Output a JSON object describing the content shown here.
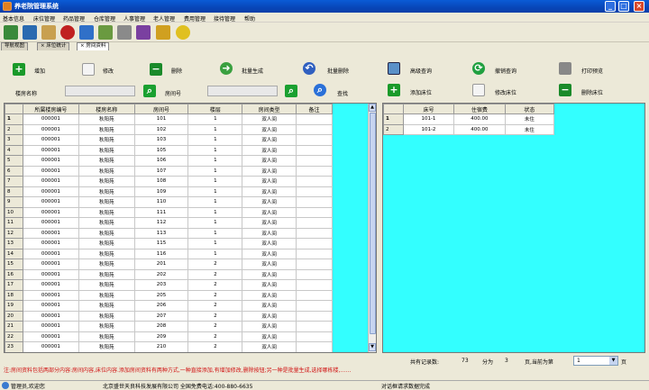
{
  "window": {
    "title": "养老院管理系统"
  },
  "menu": [
    "基本信息",
    "床位管理",
    "药品管理",
    "仓库管理",
    "人事管理",
    "老人管理",
    "费用管理",
    "接待管理",
    "帮助"
  ],
  "tabs": [
    "导航视图",
    "床位统计",
    "房间资料"
  ],
  "actions": {
    "add": "增加",
    "edit": "修改",
    "delete": "删除",
    "batch_create": "批量生成",
    "batch_delete": "批量删除",
    "advanced_query": "高级查询",
    "cancel_query": "撤销查询",
    "print_preview": "打印预览",
    "add_bed": "添加床位",
    "edit_bed": "修改床位",
    "delete_bed": "删除床位",
    "search": "查找"
  },
  "filters": {
    "building_label": "楼房名称",
    "room_label": "房间号"
  },
  "rooms_table": {
    "columns": [
      "所属楼房编号",
      "楼房名称",
      "房间号",
      "楼层",
      "房间类型",
      "备注"
    ],
    "rows": [
      [
        "000001",
        "秋阳苑",
        "101",
        "1",
        "双人间",
        ""
      ],
      [
        "000001",
        "秋阳苑",
        "102",
        "1",
        "双人间",
        ""
      ],
      [
        "000001",
        "秋阳苑",
        "103",
        "1",
        "双人间",
        ""
      ],
      [
        "000001",
        "秋阳苑",
        "105",
        "1",
        "双人间",
        ""
      ],
      [
        "000001",
        "秋阳苑",
        "106",
        "1",
        "双人间",
        ""
      ],
      [
        "000001",
        "秋阳苑",
        "107",
        "1",
        "双人间",
        ""
      ],
      [
        "000001",
        "秋阳苑",
        "108",
        "1",
        "双人间",
        ""
      ],
      [
        "000001",
        "秋阳苑",
        "109",
        "1",
        "双人间",
        ""
      ],
      [
        "000001",
        "秋阳苑",
        "110",
        "1",
        "双人间",
        ""
      ],
      [
        "000001",
        "秋阳苑",
        "111",
        "1",
        "双人间",
        ""
      ],
      [
        "000001",
        "秋阳苑",
        "112",
        "1",
        "双人间",
        ""
      ],
      [
        "000001",
        "秋阳苑",
        "113",
        "1",
        "双人间",
        ""
      ],
      [
        "000001",
        "秋阳苑",
        "115",
        "1",
        "双人间",
        ""
      ],
      [
        "000001",
        "秋阳苑",
        "116",
        "1",
        "双人间",
        ""
      ],
      [
        "000001",
        "秋阳苑",
        "201",
        "2",
        "双人间",
        ""
      ],
      [
        "000001",
        "秋阳苑",
        "202",
        "2",
        "双人间",
        ""
      ],
      [
        "000001",
        "秋阳苑",
        "203",
        "2",
        "双人间",
        ""
      ],
      [
        "000001",
        "秋阳苑",
        "205",
        "2",
        "双人间",
        ""
      ],
      [
        "000001",
        "秋阳苑",
        "206",
        "2",
        "双人间",
        ""
      ],
      [
        "000001",
        "秋阳苑",
        "207",
        "2",
        "双人间",
        ""
      ],
      [
        "000001",
        "秋阳苑",
        "208",
        "2",
        "双人间",
        ""
      ],
      [
        "000001",
        "秋阳苑",
        "209",
        "2",
        "双人间",
        ""
      ],
      [
        "000001",
        "秋阳苑",
        "210",
        "2",
        "双人间",
        ""
      ]
    ]
  },
  "beds_table": {
    "columns": [
      "床号",
      "住宿费",
      "状态"
    ],
    "rows": [
      [
        "101-1",
        "400.00",
        "未住"
      ],
      [
        "101-2",
        "400.00",
        "未住"
      ]
    ]
  },
  "pager": {
    "total_label": "共有记录数:",
    "total": "73",
    "pages_label": "分为",
    "pages": "3",
    "pages_suffix": "页,当前为第",
    "page_suffix": "页",
    "current": "1"
  },
  "note": "注:房间资料包括两部分内容:房间内容,床位内容.添加房间资料有两种方式,一种直接添加,有增加修改,删除按钮;另一种是批量生成,选择哪栋楼,……",
  "status": {
    "user": "管理员,欢迎您",
    "company": "北京盛世天良科技发展有限公司  全国免费电话:400-880-6635",
    "message": "对话框请求数据完成"
  },
  "colors": {
    "grid_bg": "#33ffff",
    "note": "#d01010",
    "titlebar": "#0a5bd6"
  }
}
